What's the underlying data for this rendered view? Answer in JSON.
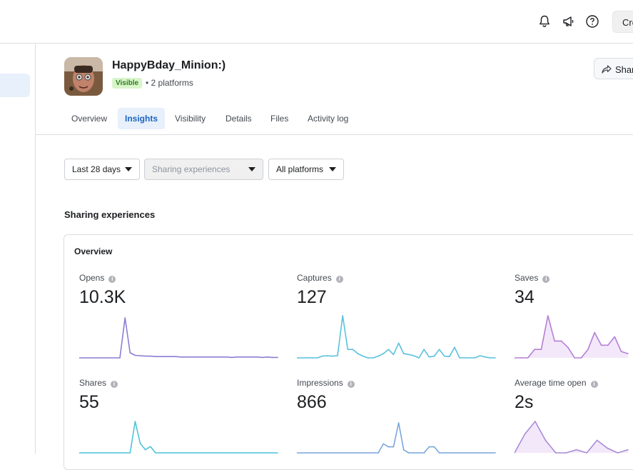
{
  "topbar": {
    "icons": [
      "bell-icon",
      "megaphone-icon",
      "help-icon"
    ],
    "create_label": "Cre"
  },
  "header": {
    "title": "HappyBday_Minion:)",
    "visibility_badge": "Visible",
    "platforms": "• 2 platforms",
    "share_label": "Share"
  },
  "tabs": [
    {
      "label": "Overview",
      "active": false
    },
    {
      "label": "Insights",
      "active": true
    },
    {
      "label": "Visibility",
      "active": false
    },
    {
      "label": "Details",
      "active": false
    },
    {
      "label": "Files",
      "active": false
    },
    {
      "label": "Activity log",
      "active": false
    }
  ],
  "filters": {
    "date_range": "Last 28 days",
    "experience": "Sharing experiences",
    "platform": "All platforms"
  },
  "section_title": "Sharing experiences",
  "card": {
    "title": "Overview",
    "metrics": [
      {
        "label": "Opens",
        "value": "10.3K",
        "color": "#8b7fd4",
        "fill": "none",
        "series": [
          0,
          0,
          0,
          0,
          0,
          0,
          0,
          0,
          0,
          0.95,
          0.12,
          0.06,
          0.05,
          0.04,
          0.04,
          0.03,
          0.03,
          0.03,
          0.03,
          0.03,
          0.02,
          0.02,
          0.02,
          0.02,
          0.02,
          0.02,
          0.02,
          0.02,
          0.02,
          0.02,
          0.01,
          0.02,
          0.02,
          0.02,
          0.02,
          0.02,
          0.01,
          0.02,
          0.01,
          0.01
        ]
      },
      {
        "label": "Captures",
        "value": "127",
        "color": "#5bc0de",
        "fill": "none",
        "series": [
          0,
          0,
          0,
          0,
          0,
          0.04,
          0.05,
          0.04,
          0.05,
          1.0,
          0.2,
          0.2,
          0.1,
          0.04,
          0.0,
          0.0,
          0.04,
          0.1,
          0.2,
          0.08,
          0.35,
          0.1,
          0.08,
          0.05,
          0.0,
          0.2,
          0.02,
          0.04,
          0.2,
          0.04,
          0.03,
          0.25,
          0.0,
          0.0,
          0.0,
          0.0,
          0.05,
          0.02,
          0.0,
          0.0
        ]
      },
      {
        "label": "Saves",
        "value": "34",
        "color": "#b57ed6",
        "fill": "#f3e8fa",
        "series": [
          0,
          0,
          0,
          0.2,
          0.2,
          1.0,
          0.4,
          0.4,
          0.25,
          0,
          0,
          0.2,
          0.6,
          0.3,
          0.3,
          0.5,
          0.15,
          0.1
        ]
      },
      {
        "label": "Shares",
        "value": "55",
        "color": "#4fc3d9",
        "fill": "none",
        "series": [
          0,
          0,
          0,
          0,
          0,
          0,
          0,
          0,
          0,
          0,
          0,
          1.0,
          0.3,
          0.1,
          0.2,
          0,
          0,
          0,
          0,
          0,
          0,
          0,
          0,
          0,
          0,
          0,
          0,
          0,
          0,
          0,
          0,
          0,
          0,
          0,
          0,
          0,
          0,
          0,
          0,
          0
        ]
      },
      {
        "label": "Impressions",
        "value": "866",
        "color": "#7aa6dc",
        "fill": "none",
        "series": [
          0,
          0,
          0,
          0,
          0,
          0,
          0,
          0,
          0,
          0,
          0,
          0,
          0,
          0,
          0,
          0,
          0,
          0.3,
          0.2,
          0.2,
          1.0,
          0.1,
          0,
          0,
          0,
          0,
          0.2,
          0.2,
          0,
          0,
          0,
          0,
          0,
          0,
          0,
          0,
          0,
          0,
          0,
          0
        ]
      },
      {
        "label": "Average time open",
        "value": "2s",
        "color": "#a98bd6",
        "fill": "#f3e8fa",
        "series": [
          0,
          0.6,
          1.0,
          0.4,
          0,
          0,
          0.1,
          0,
          0.4,
          0.15,
          0,
          0.1
        ]
      }
    ]
  }
}
